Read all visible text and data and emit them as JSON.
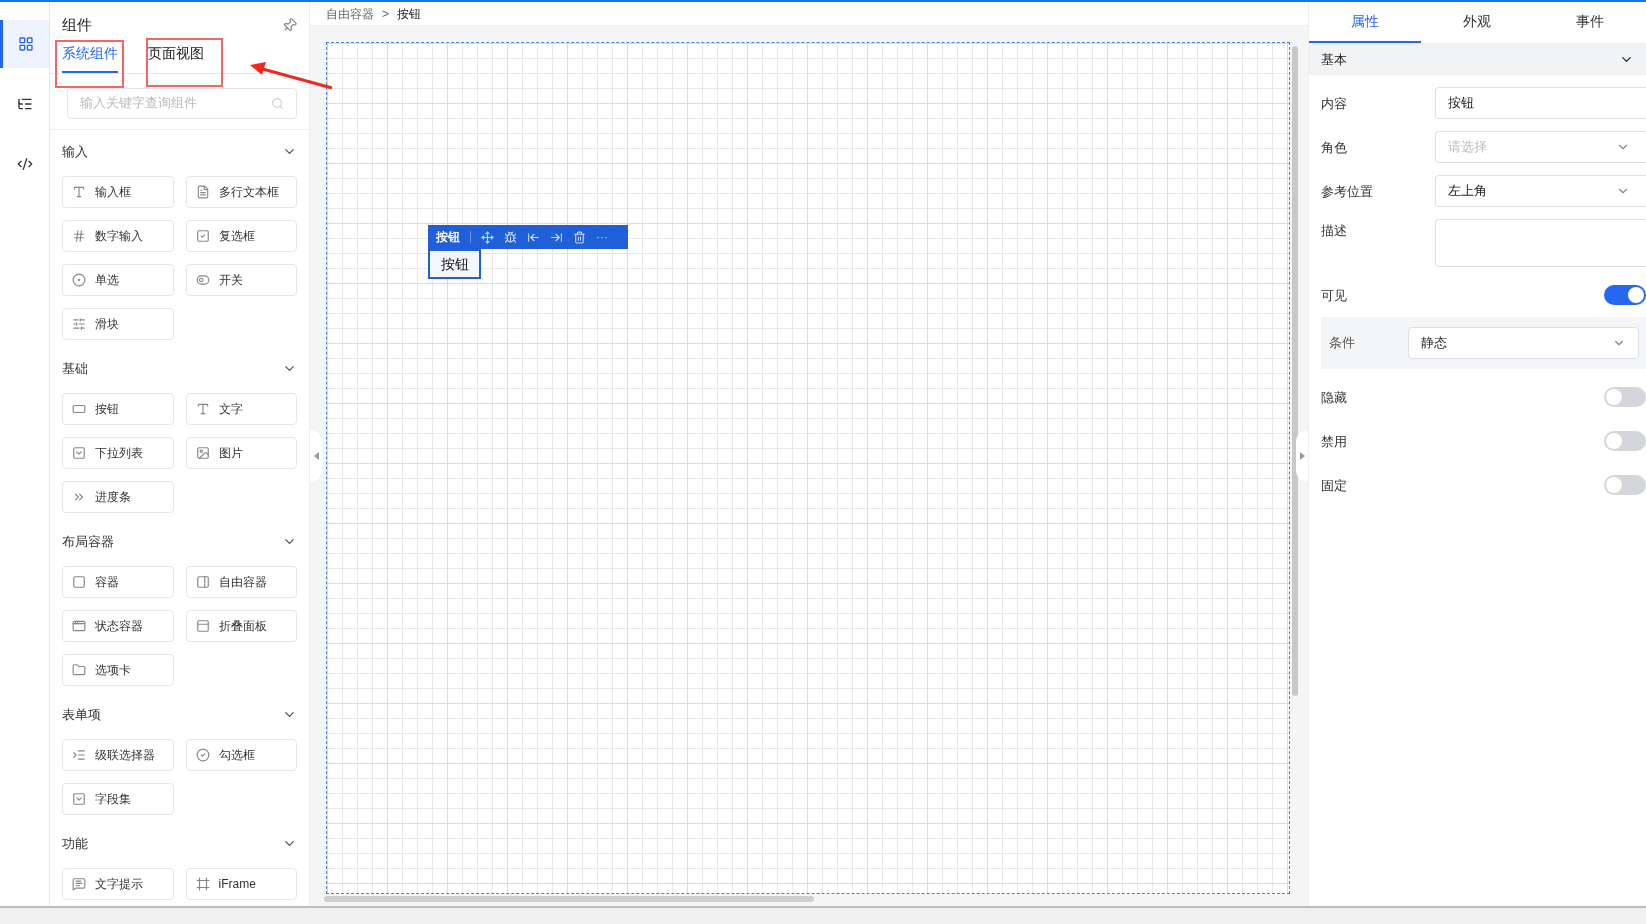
{
  "rail": [
    {
      "selected": true
    },
    {
      "selected": false
    },
    {
      "selected": false
    }
  ],
  "panel": {
    "title": "组件",
    "tabs": [
      {
        "label": "系统组件",
        "selected": true
      },
      {
        "label": "页面视图",
        "selected": false
      }
    ],
    "search": {
      "placeholder": "输入关键字查询组件"
    },
    "sections": [
      {
        "title": "输入",
        "expanded": true,
        "items": [
          {
            "label": "输入框"
          },
          {
            "label": "多行文本框"
          },
          {
            "label": "数字输入"
          },
          {
            "label": "复选框"
          },
          {
            "label": "单选"
          },
          {
            "label": "开关"
          },
          {
            "label": "滑块"
          }
        ]
      },
      {
        "title": "基础",
        "expanded": true,
        "items": [
          {
            "label": "按钮"
          },
          {
            "label": "文字"
          },
          {
            "label": "下拉列表"
          },
          {
            "label": "图片"
          },
          {
            "label": "进度条"
          }
        ]
      },
      {
        "title": "布局容器",
        "expanded": true,
        "items": [
          {
            "label": "容器"
          },
          {
            "label": "自由容器"
          },
          {
            "label": "状态容器"
          },
          {
            "label": "折叠面板"
          },
          {
            "label": "选项卡"
          }
        ]
      },
      {
        "title": "表单项",
        "expanded": true,
        "items": [
          {
            "label": "级联选择器"
          },
          {
            "label": "勾选框"
          },
          {
            "label": "字段集"
          }
        ]
      },
      {
        "title": "功能",
        "expanded": true,
        "items": [
          {
            "label": "文字提示"
          },
          {
            "label": "iFrame"
          }
        ]
      }
    ]
  },
  "breadcrumb": [
    "自由容器",
    ">",
    "按钮"
  ],
  "canvas": {
    "toolbar_label": "按钮",
    "tool_more": "···",
    "element_text": "按钮"
  },
  "inspector": {
    "tabs": [
      {
        "label": "属性",
        "selected": true
      },
      {
        "label": "外观",
        "selected": false
      },
      {
        "label": "事件",
        "selected": false
      }
    ],
    "section": {
      "title": "基本",
      "expanded": true
    },
    "rows": [
      {
        "kind": "input",
        "label": "内容",
        "value": "按钮"
      },
      {
        "kind": "select",
        "label": "角色",
        "placeholder": "请选择"
      },
      {
        "kind": "select",
        "label": "参考位置",
        "value": "左上角"
      },
      {
        "kind": "textarea",
        "label": "描述"
      },
      {
        "kind": "toggle",
        "label": "可见",
        "on": true,
        "condition": {
          "label": "条件",
          "value": "静态"
        }
      },
      {
        "kind": "toggle",
        "label": "隐藏",
        "on": false
      },
      {
        "kind": "toggle",
        "label": "禁用",
        "on": false
      },
      {
        "kind": "toggle",
        "label": "固定",
        "on": false
      }
    ]
  }
}
